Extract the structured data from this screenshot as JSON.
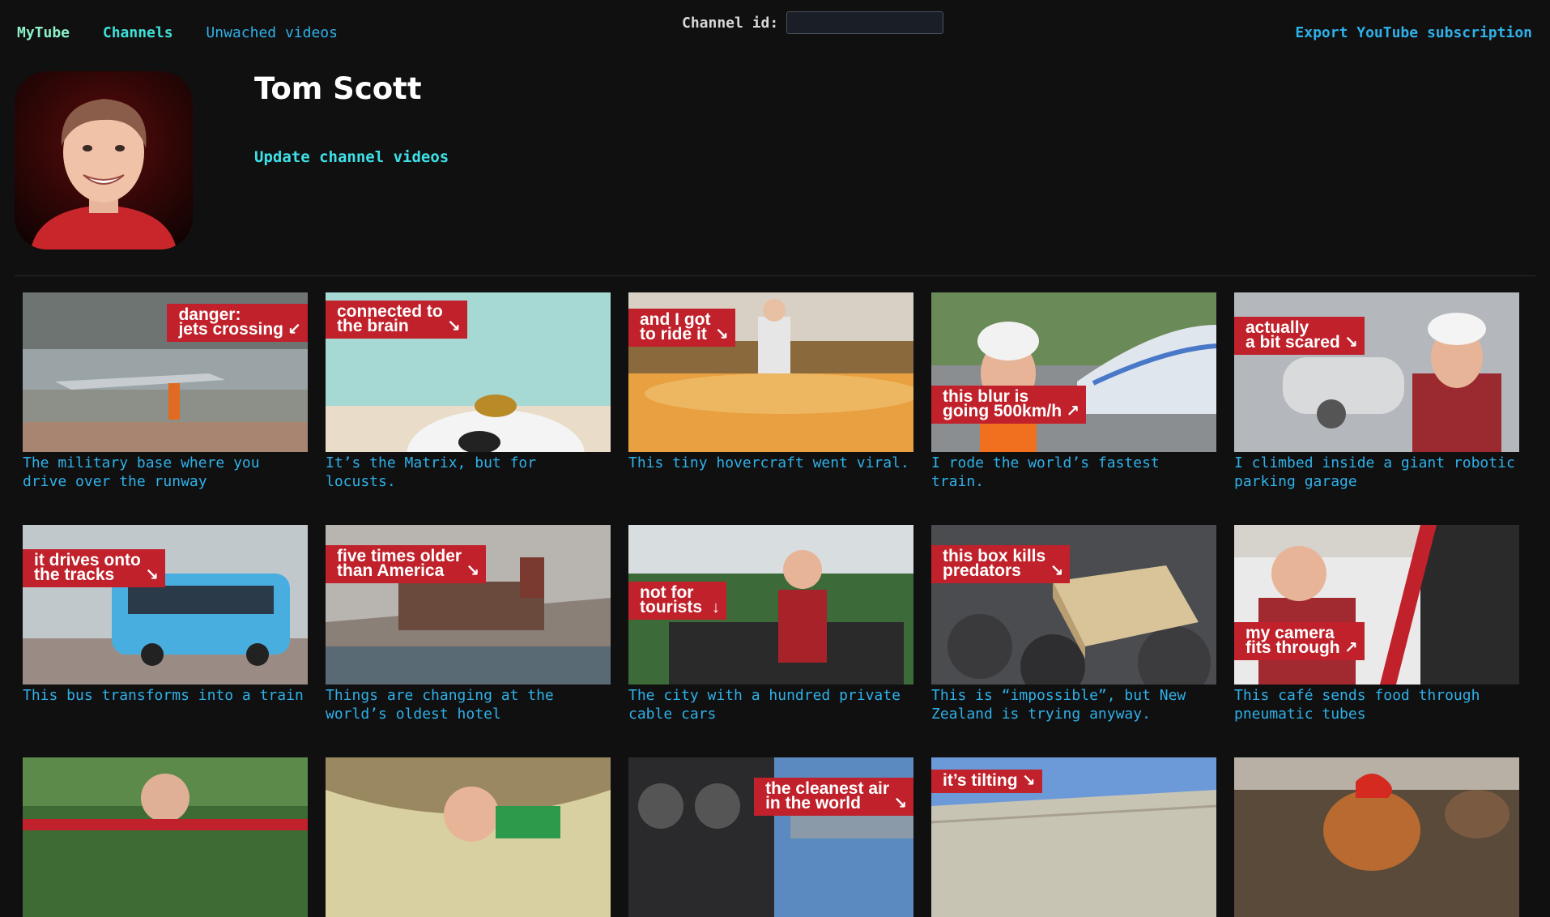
{
  "nav": {
    "home": "MyTube",
    "channels": "Channels",
    "unwatched": "Unwached videos"
  },
  "channel_id": {
    "label": "Channel id:",
    "value": "",
    "placeholder": ""
  },
  "export_label": "Export YouTube subscription",
  "channel": {
    "name": "Tom Scott",
    "update_label": "Update channel videos"
  },
  "colors": {
    "background": "#101010",
    "link": "#2fb0e8",
    "accent": "#3ee0e8",
    "thumb_caption": "#c0212b"
  },
  "videos": [
    {
      "title": "The military base where you drive over the runway",
      "caption": "danger:\njets crossing",
      "arrow": "↙"
    },
    {
      "title": "It’s the Matrix, but for locusts.",
      "caption": "connected to\nthe brain",
      "arrow": "↘"
    },
    {
      "title": "This tiny hovercraft went viral.",
      "caption": "and I got\nto ride it",
      "arrow": "↘"
    },
    {
      "title": "I rode the world’s fastest train.",
      "caption": "this blur is\ngoing 500km/h",
      "arrow": "↗"
    },
    {
      "title": "I climbed inside a giant robotic parking garage",
      "caption": "actually\na bit scared",
      "arrow": "↘"
    },
    {
      "title": "This bus transforms into a train",
      "caption": "it drives onto\nthe tracks",
      "arrow": "↘"
    },
    {
      "title": "Things are changing at the world’s oldest hotel",
      "caption": "five times older\nthan America",
      "arrow": "↘"
    },
    {
      "title": "The city with a hundred private cable cars",
      "caption": "not for\ntourists",
      "arrow": "↓"
    },
    {
      "title": "This is “impossible”, but New Zealand is trying anyway.",
      "caption": "this box kills\npredators",
      "arrow": "↘"
    },
    {
      "title": "This café sends food through pneumatic tubes",
      "caption": "my camera\nfits through",
      "arrow": "↗"
    },
    {
      "title": "",
      "caption": "",
      "arrow": ""
    },
    {
      "title": "",
      "caption": "",
      "arrow": ""
    },
    {
      "title": "",
      "caption": "the cleanest air\nin the world",
      "arrow": "↘"
    },
    {
      "title": "",
      "caption": "it’s tilting",
      "arrow": "↘"
    },
    {
      "title": "",
      "caption": "",
      "arrow": ""
    }
  ]
}
